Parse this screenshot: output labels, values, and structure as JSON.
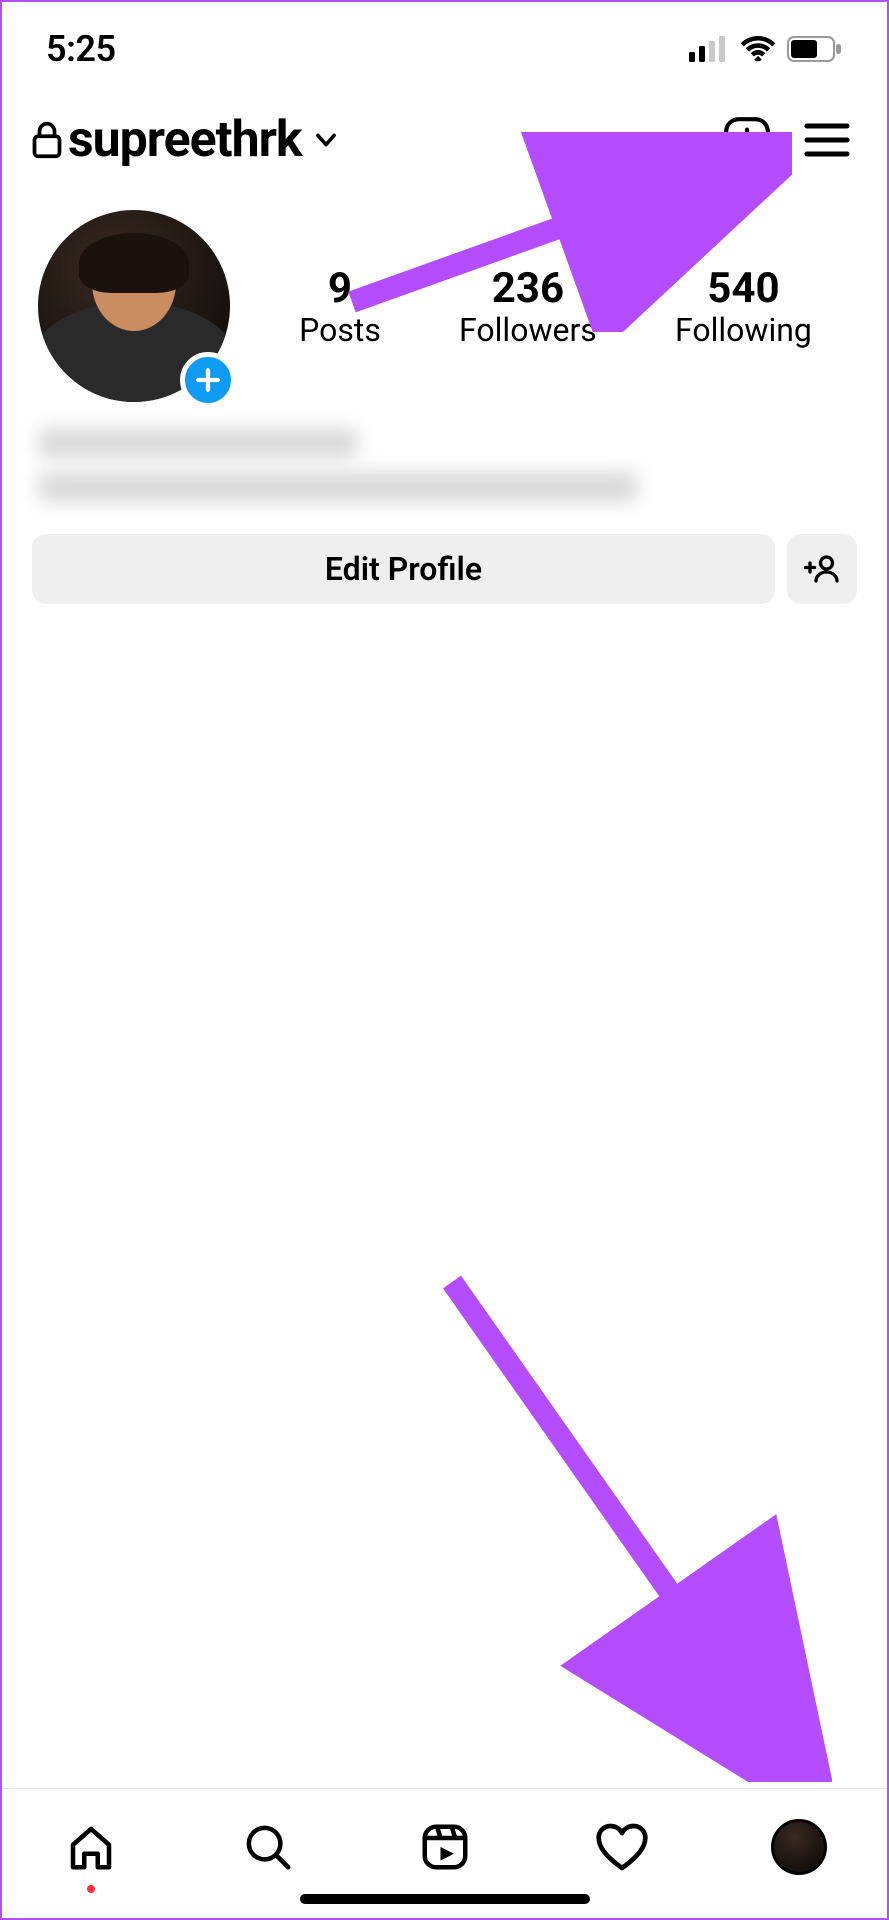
{
  "status": {
    "time": "5:25"
  },
  "header": {
    "username": "supreethrk"
  },
  "stats": {
    "posts": {
      "count": "9",
      "label": "Posts"
    },
    "followers": {
      "count": "236",
      "label": "Followers"
    },
    "following": {
      "count": "540",
      "label": "Following"
    }
  },
  "actions": {
    "edit_profile": "Edit Profile"
  },
  "annotation": {
    "arrow_color": "#b44dff"
  }
}
